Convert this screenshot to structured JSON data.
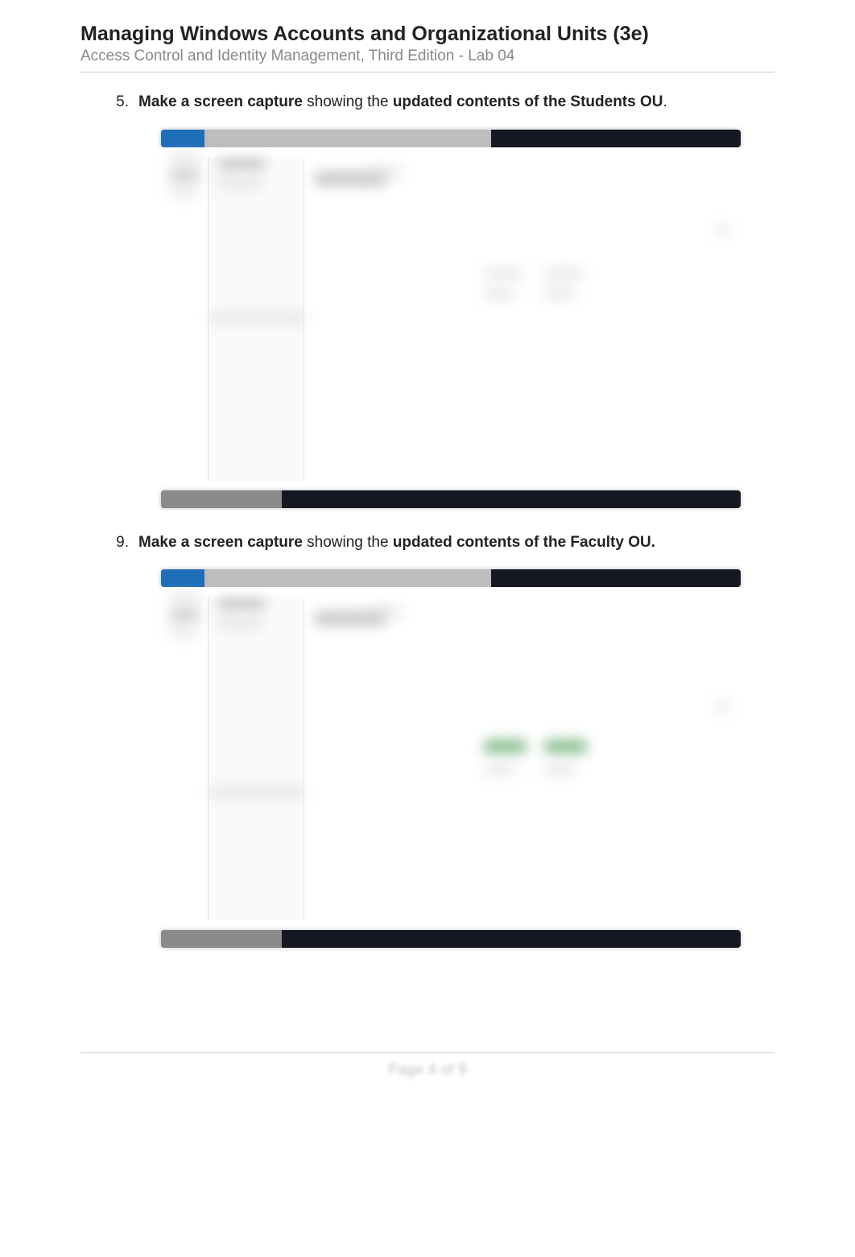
{
  "header": {
    "title": "Managing Windows Accounts and Organizational Units (3e)",
    "subtitle": "Access Control and Identity Management, Third Edition - Lab 04"
  },
  "instructions": [
    {
      "number": "5.",
      "bold_prefix": "Make a screen capture",
      "mid_text": " showing the ",
      "bold_suffix": "updated contents of the Students OU",
      "period": "."
    },
    {
      "number": "9.",
      "bold_prefix": "Make a screen capture",
      "mid_text": " showing the ",
      "bold_suffix": "updated contents of the Faculty OU.",
      "period": ""
    }
  ],
  "footer": {
    "text": "Page 4 of 9"
  }
}
